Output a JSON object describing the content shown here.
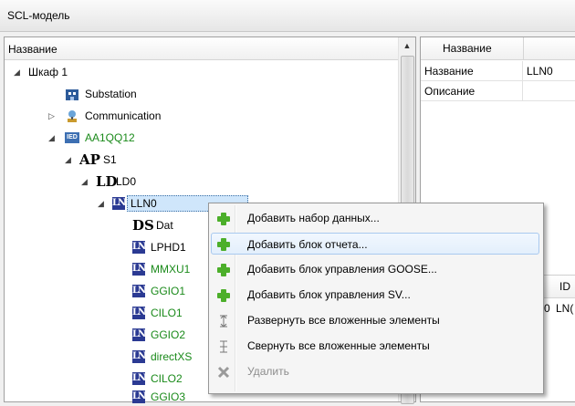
{
  "window": {
    "title": "SCL-модель"
  },
  "tree": {
    "column_header": "Название",
    "rows": [
      {
        "label": "Шкаф 1",
        "icon": "cabinet-icon",
        "expander": "expanded"
      },
      {
        "label": "Substation",
        "icon": "substation-icon",
        "expander": "none"
      },
      {
        "label": "Communication",
        "icon": "communication-icon",
        "expander": "collapsed"
      },
      {
        "label": "AA1QQ12",
        "icon": "ied-icon",
        "icon_text": "IED",
        "expander": "expanded"
      },
      {
        "label": "S1",
        "icon": "access-point-icon",
        "icon_text": "AP",
        "expander": "expanded"
      },
      {
        "label": "LD0",
        "icon": "logical-device-icon",
        "icon_text": "LD",
        "expander": "expanded"
      },
      {
        "label": "LLN0",
        "icon": "logical-node-icon",
        "icon_text": "LN",
        "expander": "expanded"
      },
      {
        "label": "Dat",
        "icon": "dataset-icon",
        "icon_text": "DS",
        "expander": "none"
      },
      {
        "label": "LPHD1",
        "icon": "logical-node-icon",
        "icon_text": "LN",
        "expander": "none"
      },
      {
        "label": "MMXU1",
        "icon": "logical-node-icon",
        "icon_text": "LN",
        "expander": "none"
      },
      {
        "label": "GGIO1",
        "icon": "logical-node-icon",
        "icon_text": "LN",
        "expander": "none"
      },
      {
        "label": "CILO1",
        "icon": "logical-node-icon",
        "icon_text": "LN",
        "expander": "none"
      },
      {
        "label": "GGIO2",
        "icon": "logical-node-icon",
        "icon_text": "LN",
        "expander": "none"
      },
      {
        "label": "directXS",
        "icon": "logical-node-icon",
        "icon_text": "LN",
        "expander": "none"
      },
      {
        "label": "CILO2",
        "icon": "logical-node-icon",
        "icon_text": "LN",
        "expander": "none"
      },
      {
        "label": "GGIO3",
        "icon": "logical-node-icon",
        "icon_text": "LN",
        "expander": "none"
      }
    ]
  },
  "properties": {
    "column_header": "Название",
    "rows": [
      {
        "name": "Название",
        "value": "LLN0"
      },
      {
        "name": "Описание",
        "value": ""
      }
    ]
  },
  "lower_grid": {
    "col1": "ID",
    "cell_prefix": "0",
    "cell_value": "LN("
  },
  "context_menu": {
    "items": [
      {
        "label": "Добавить набор данных...",
        "icon": "add-icon"
      },
      {
        "label": "Добавить блок отчета...",
        "icon": "add-icon",
        "highlighted": true
      },
      {
        "label": "Добавить блок управления GOOSE...",
        "icon": "add-icon"
      },
      {
        "label": "Добавить блок управления SV...",
        "icon": "add-icon"
      },
      {
        "label": "Развернуть все вложенные элементы",
        "icon": "expand-all-icon"
      },
      {
        "label": "Свернуть все вложенные элементы",
        "icon": "collapse-all-icon"
      },
      {
        "label": "Удалить",
        "icon": "delete-icon",
        "disabled": true
      }
    ]
  },
  "colors": {
    "accent_green": "#1a8a1a",
    "ln_icon_bg": "#2b3a93",
    "selection": "#cfe6fb"
  }
}
